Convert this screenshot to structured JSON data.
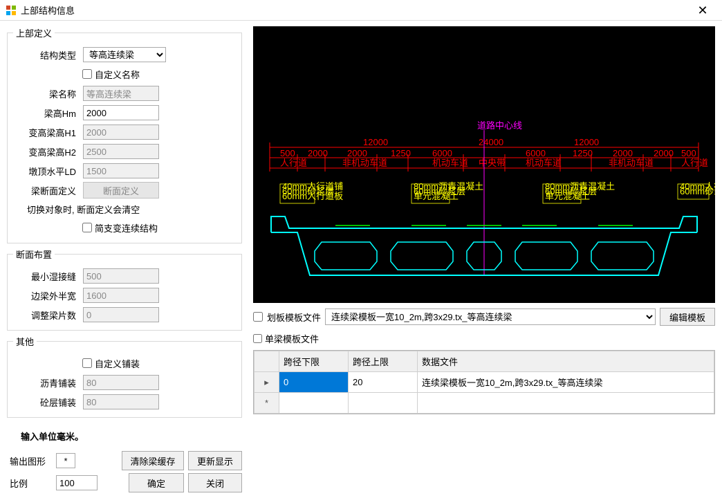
{
  "window": {
    "title": "上部结构信息"
  },
  "upper_def": {
    "legend": "上部定义",
    "struct_type_label": "结构类型",
    "struct_type_value": "等高连续梁",
    "custom_name_label": "自定义名称",
    "beam_name_label": "梁名称",
    "beam_name_value": "等高连续梁",
    "beam_hm_label": "梁高Hm",
    "beam_hm_value": "2000",
    "var_h1_label": "变高梁高H1",
    "var_h1_value": "2000",
    "var_h2_label": "变高梁高H2",
    "var_h2_value": "2500",
    "pier_ld_label": "墩顶水平LD",
    "pier_ld_value": "1500",
    "sec_def_label": "梁断面定义",
    "sec_def_btn": "断面定义",
    "switch_note": "切换对象时, 断面定义会清空",
    "simple_cont_label": "简支变连续结构"
  },
  "section_layout": {
    "legend": "断面布置",
    "min_seam_label": "最小湿接缝",
    "min_seam_value": "500",
    "edge_half_label": "边梁外半宽",
    "edge_half_value": "1600",
    "adj_count_label": "调整梁片数",
    "adj_count_value": "0"
  },
  "other": {
    "legend": "其他",
    "custom_pave_label": "自定义铺装",
    "asphalt_label": "沥青铺装",
    "asphalt_value": "80",
    "concrete_label": "砼层铺装",
    "concrete_value": "80"
  },
  "bottom": {
    "unit_note": "输入单位毫米。",
    "output_fig_label": "输出图形",
    "output_fig_btn": "*",
    "clear_cache_btn": "清除梁缓存",
    "refresh_btn": "更新显示",
    "ratio_label": "比例",
    "ratio_value": "100",
    "ok_btn": "确定",
    "close_btn": "关闭"
  },
  "template": {
    "plate_file_label": "划板模板文件",
    "plate_file_value": "连续梁模板一宽10_2m,跨3x29.tx_等高连续梁",
    "beam_file_label": "单梁模板文件",
    "edit_btn": "编辑模板"
  },
  "grid": {
    "headers": [
      "跨径下限",
      "跨径上限",
      "数据文件"
    ],
    "rows": [
      {
        "lower": "0",
        "upper": "20",
        "file": "连续梁模板一宽10_2m,跨3x29.tx_等高连续梁"
      }
    ],
    "row_ptr": "▸",
    "row_new": "*"
  }
}
